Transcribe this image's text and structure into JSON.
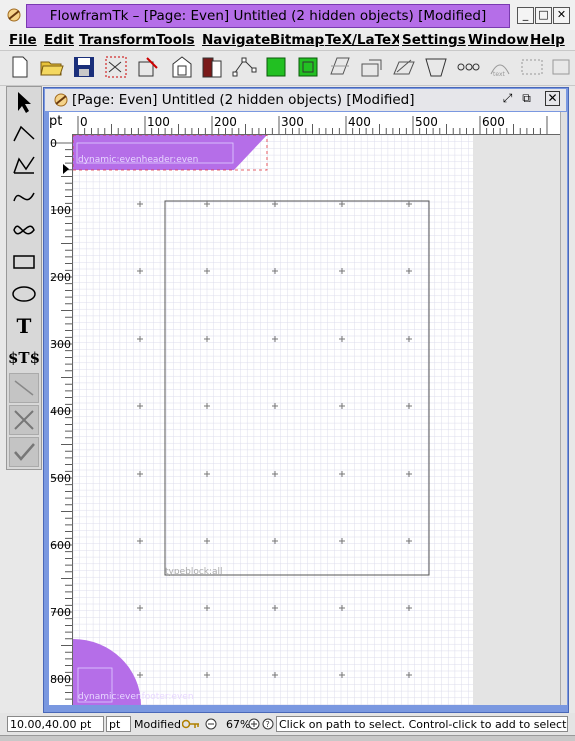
{
  "window": {
    "title": "FlowframTk – [Page: Even] Untitled (2 hidden objects) [Modified]",
    "controls": [
      "minimize",
      "maximize",
      "close"
    ]
  },
  "menubar": {
    "items": [
      {
        "label": "File"
      },
      {
        "label": "Edit"
      },
      {
        "label": "Transform"
      },
      {
        "label": "Tools"
      },
      {
        "label": "Navigate"
      },
      {
        "label": "Bitmap"
      },
      {
        "label": "TeX/LaTeX"
      },
      {
        "label": "Settings"
      },
      {
        "label": "Window"
      },
      {
        "label": "Help"
      }
    ]
  },
  "toolbar": {
    "buttons": [
      "new-icon",
      "open-folder-icon",
      "save-icon",
      "select-all-icon",
      "edit-path-icon",
      "frames-icon",
      "book-icon",
      "grid-nodes-icon",
      "green-square-icon",
      "green-select-icon",
      "transform-icon",
      "rotate-icon",
      "scale-icon",
      "shear-icon",
      "distort-icon",
      "flow-icon",
      "text-path-icon",
      "hide-icon"
    ]
  },
  "palette": {
    "tools": [
      "select-arrow-icon",
      "open-line-icon",
      "closed-line-icon",
      "open-curve-icon",
      "closed-curve-icon",
      "rectangle-icon",
      "ellipse-icon",
      "text-tool-icon",
      "math-text-tool-icon",
      "disabled-line-icon",
      "disabled-cross-icon",
      "disabled-check-icon"
    ],
    "text_label": "T",
    "math_label": "$T$"
  },
  "document": {
    "frame_title": "[Page: Even] Untitled (2 hidden objects) [Modified]",
    "unit_label": "pt",
    "hruler_labels": [
      "0",
      "100",
      "200",
      "300",
      "400",
      "500",
      "600"
    ],
    "vruler_labels": [
      "0",
      "100",
      "200",
      "300",
      "400",
      "500",
      "600",
      "700",
      "800"
    ],
    "header_frame_label": "dynamic:evenheader:even",
    "body_frame_label": "typeblock:all",
    "footer_frame_label": "dynamic:evenfooter:even",
    "accent_color": "#b56ee8"
  },
  "status": {
    "coords": "10.00,40.00 pt",
    "unit": "pt",
    "modified": "Modified",
    "zoom": "67%",
    "message": "Click on path to select. Control-click to add to selection. Dou"
  }
}
